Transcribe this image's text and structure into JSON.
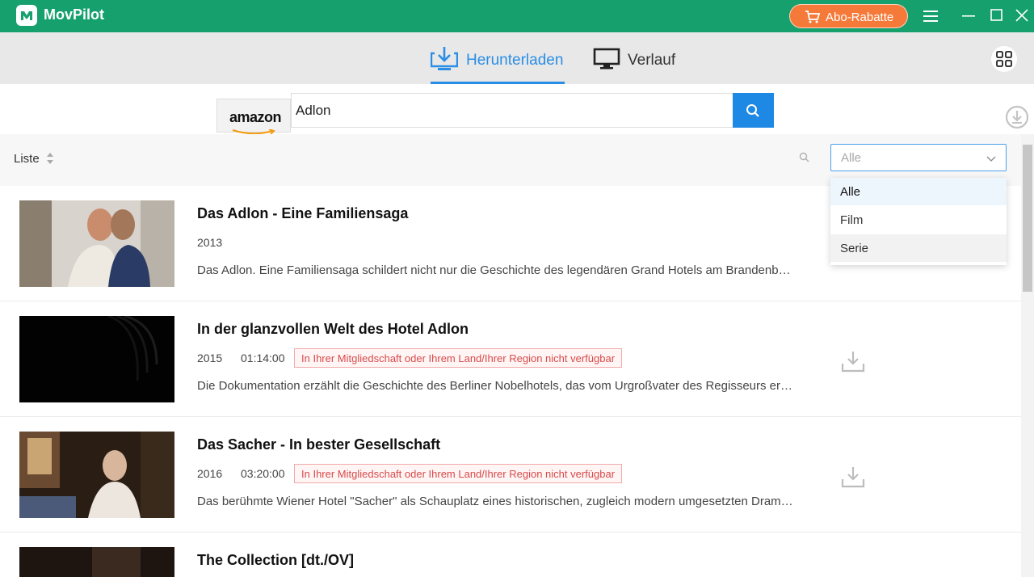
{
  "app": {
    "title": "MovPilot"
  },
  "titlebar": {
    "promo_label": "Abo-Rabatte"
  },
  "nav": {
    "tabs": [
      {
        "label": "Herunterladen",
        "active": true
      },
      {
        "label": "Verlauf",
        "active": false
      }
    ]
  },
  "search": {
    "service": "amazon",
    "query": "Adlon"
  },
  "list": {
    "sort_label": "Liste"
  },
  "filter": {
    "selected": "Alle",
    "options": [
      "Alle",
      "Film",
      "Serie"
    ]
  },
  "colors": {
    "brand_green": "#15a06e",
    "accent_blue": "#2a8ee6",
    "promo_orange": "#f57a3a",
    "warning_red": "#d94a4a"
  },
  "results": [
    {
      "title": "Das Adlon - Eine Familiensaga",
      "year": "2013",
      "duration": "",
      "badge": "",
      "description": "Das Adlon. Eine Familiensaga schildert nicht nur die Geschichte des legendären Grand Hotels am Brandenbur..."
    },
    {
      "title": "In der glanzvollen Welt des Hotel Adlon",
      "year": "2015",
      "duration": "01:14:00",
      "badge": "In Ihrer Mitgliedschaft oder Ihrem Land/Ihrer Region nicht verfügbar",
      "description": "Die Dokumentation erzählt die Geschichte des Berliner Nobelhotels, das vom Urgroßvater des Regisseurs erri..."
    },
    {
      "title": "Das Sacher - In bester Gesellschaft",
      "year": "2016",
      "duration": "03:20:00",
      "badge": "In Ihrer Mitgliedschaft oder Ihrem Land/Ihrer Region nicht verfügbar",
      "description": "Das berühmte Wiener Hotel \"Sacher\" als Schauplatz eines historischen, zugleich modern umgesetzten Drama..."
    },
    {
      "title": "The Collection [dt./OV]",
      "year": "",
      "duration": "",
      "badge": "",
      "description": ""
    }
  ]
}
